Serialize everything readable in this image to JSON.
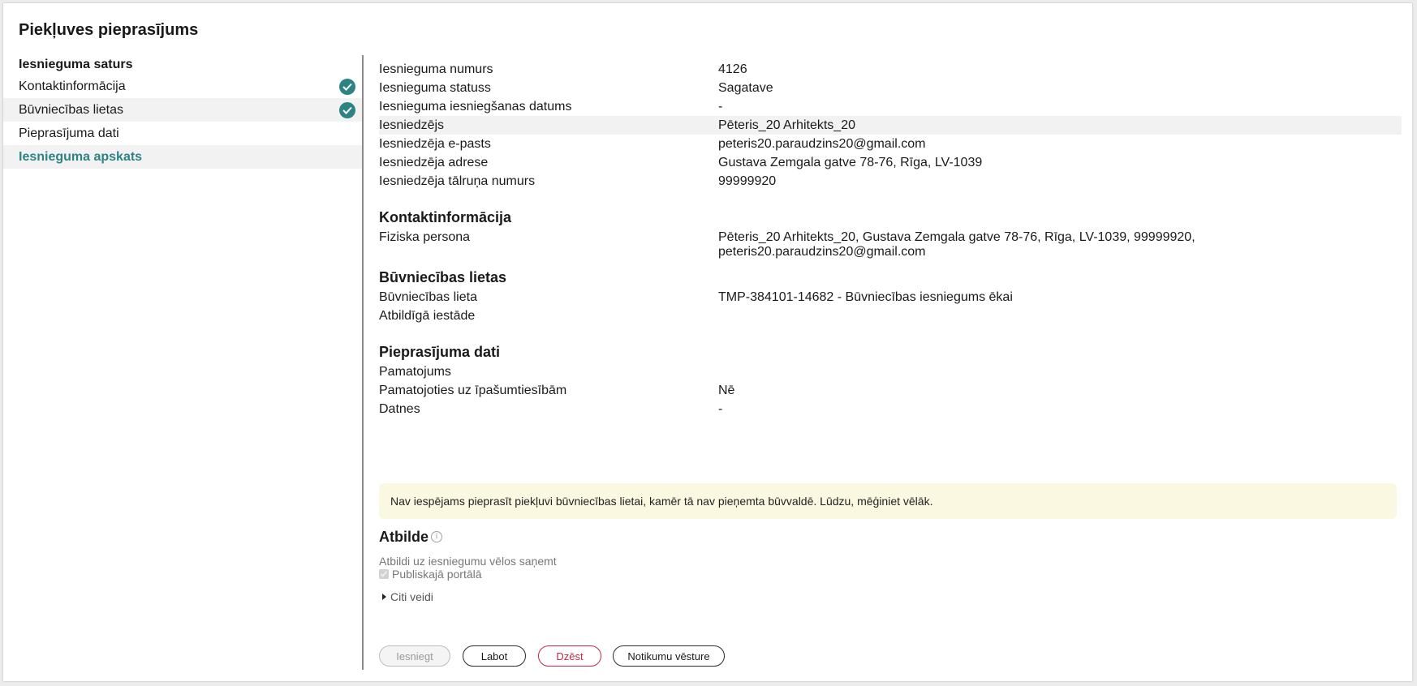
{
  "page": {
    "title": "Piekļuves pieprasījums"
  },
  "sidebar": {
    "heading": "Iesnieguma saturs",
    "items": [
      {
        "label": "Kontaktinformācija",
        "completed": true
      },
      {
        "label": "Būvniecības lietas",
        "completed": true
      },
      {
        "label": "Pieprasījuma dati",
        "completed": false
      },
      {
        "label": "Iesnieguma apskats",
        "active": true
      }
    ]
  },
  "summary": [
    {
      "label": "Iesnieguma numurs",
      "value": "4126"
    },
    {
      "label": "Iesnieguma statuss",
      "value": "Sagatave"
    },
    {
      "label": "Iesnieguma iesniegšanas datums",
      "value": "-"
    },
    {
      "label": "Iesniedzējs",
      "value": "Pēteris_20 Arhitekts_20"
    },
    {
      "label": "Iesniedzēja e-pasts",
      "value": "peteris20.paraudzins20@gmail.com"
    },
    {
      "label": "Iesniedzēja adrese",
      "value": "Gustava Zemgala gatve 78-76, Rīga, LV-1039"
    },
    {
      "label": "Iesniedzēja tālruņa numurs",
      "value": "99999920"
    }
  ],
  "contact": {
    "title": "Kontaktinformācija",
    "rows": [
      {
        "label": "Fiziska persona",
        "value": "Pēteris_20 Arhitekts_20, Gustava Zemgala gatve 78-76, Rīga, LV-1039, 99999920, peteris20.paraudzins20@gmail.com"
      }
    ]
  },
  "construction": {
    "title": "Būvniecības lietas",
    "rows": [
      {
        "label": "Būvniecības lieta",
        "value": "TMP-384101-14682 - Būvniecības iesniegums ēkai"
      },
      {
        "label": "Atbildīgā iestāde",
        "value": ""
      }
    ]
  },
  "request": {
    "title": "Pieprasījuma dati",
    "rows": [
      {
        "label": "Pamatojums",
        "value": ""
      },
      {
        "label": "Pamatojoties uz īpašumtiesībām",
        "value": "Nē"
      },
      {
        "label": "Datnes",
        "value": "-"
      }
    ]
  },
  "notice": "Nav iespējams pieprasīt piekļuvi būvniecības lietai, kamēr tā nav pieņemta būvvaldē. Lūdzu, mēģiniet vēlāk.",
  "answer": {
    "title": "Atbilde",
    "info_icon": "i",
    "subtitle": "Atbildi uz iesniegumu vēlos saņemt",
    "checkbox_label": "Publiskajā portālā",
    "checkbox_checked": true,
    "more_label": "Citi veidi"
  },
  "buttons": {
    "submit": "Iesniegt",
    "edit": "Labot",
    "delete": "Dzēst",
    "history": "Notikumu vēsture"
  },
  "colors": {
    "accent": "#2d8383",
    "danger": "#c2294a",
    "notice_bg": "#fbf8e1"
  }
}
